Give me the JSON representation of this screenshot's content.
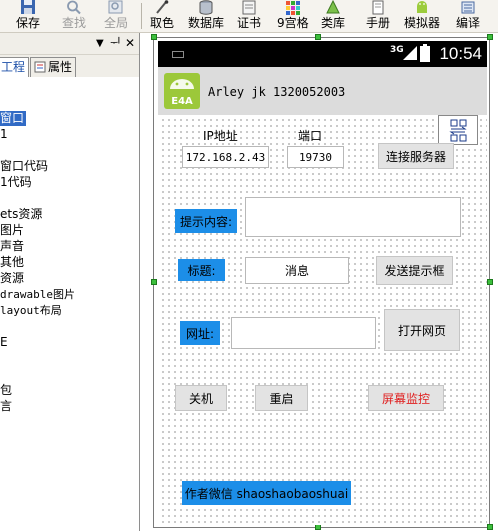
{
  "toolbar": {
    "items": [
      {
        "label": "保存",
        "icon": "save-icon",
        "enabled": true
      },
      {
        "label": "查找",
        "icon": "search-icon",
        "enabled": false
      },
      {
        "label": "全局",
        "icon": "global-search-icon",
        "enabled": false
      },
      {
        "label": "取色",
        "icon": "color-picker-icon",
        "enabled": true
      },
      {
        "label": "数据库",
        "icon": "database-icon",
        "enabled": true
      },
      {
        "label": "证书",
        "icon": "certificate-icon",
        "enabled": true
      },
      {
        "label": "9宫格",
        "icon": "grid-icon",
        "enabled": true
      },
      {
        "label": "类库",
        "icon": "library-icon",
        "enabled": true
      },
      {
        "label": "手册",
        "icon": "manual-icon",
        "enabled": true
      },
      {
        "label": "模拟器",
        "icon": "emulator-icon",
        "enabled": true
      },
      {
        "label": "编译",
        "icon": "compile-icon",
        "enabled": true
      }
    ]
  },
  "left_panel": {
    "controls": {
      "dropdown": "▼",
      "pin": "ᅱ",
      "close": "✕"
    },
    "tabs": [
      "工程",
      "属性"
    ],
    "tree": [
      {
        "label": "窗口",
        "selected": true
      },
      {
        "label": "1",
        "selected": false
      },
      {
        "label": "窗口代码",
        "selected": false
      },
      {
        "label": "1代码",
        "selected": false
      },
      {
        "label": "ets资源",
        "selected": false
      },
      {
        "label": "图片",
        "selected": false
      },
      {
        "label": "声音",
        "selected": false
      },
      {
        "label": "其他",
        "selected": false
      },
      {
        "label": "资源",
        "selected": false
      },
      {
        "label": "drawable图片",
        "selected": false
      },
      {
        "label": "layout布局",
        "selected": false
      },
      {
        "label": "E",
        "selected": false
      },
      {
        "label": "包",
        "selected": false
      },
      {
        "label": "言",
        "selected": false
      }
    ]
  },
  "phone": {
    "status": {
      "network": "3G",
      "time": "10:54"
    },
    "app_title": "Arley jk 1320052003",
    "logo_text": "E4A",
    "form": {
      "ip_label": "IP地址",
      "port_label": "端口",
      "ip_value": "172.168.2.43",
      "port_value": "19730",
      "connect_button": "连接服务器",
      "tip_label": "提示内容:",
      "tip_value": "",
      "title_label": "标题:",
      "title_value": "消息",
      "send_tip_button": "发送提示框",
      "url_label": "网址:",
      "url_value": "",
      "open_web_button": "打开网页",
      "shutdown_button": "关机",
      "restart_button": "重启",
      "screen_monitor_button": "屏幕监控",
      "author_label": "作者微信 shaoshaobaoshuai"
    },
    "colors": {
      "blue_label": "#1c8ee8",
      "monitor_text": "#e02020",
      "handle": "#3cbf3c"
    }
  }
}
